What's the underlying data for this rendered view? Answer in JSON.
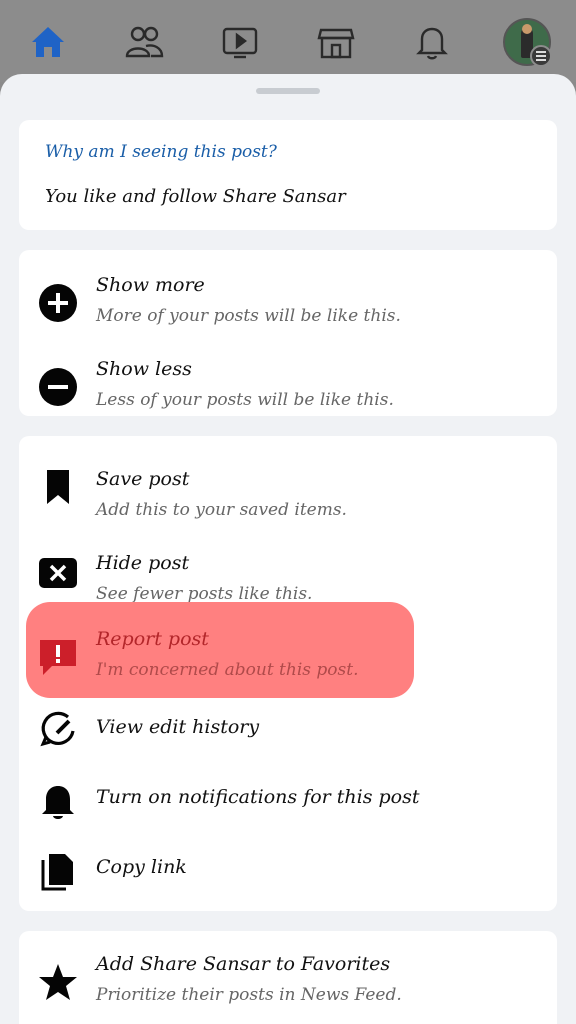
{
  "nav": {
    "icons": [
      "home-icon",
      "friends-icon",
      "watch-icon",
      "marketplace-icon",
      "bell-icon",
      "avatar"
    ]
  },
  "why": {
    "title": "Why am I seeing this post?",
    "reason": "You like and follow Share Sansar"
  },
  "feed_controls": [
    {
      "label": "Show more",
      "sub": "More of your posts will be like this.",
      "icon": "plus-circle-icon"
    },
    {
      "label": "Show less",
      "sub": "Less of your posts will be like this.",
      "icon": "minus-circle-icon"
    }
  ],
  "actions": [
    {
      "label": "Save post",
      "sub": "Add this to your saved items.",
      "icon": "bookmark-icon"
    },
    {
      "label": "Hide post",
      "sub": "See fewer posts like this.",
      "icon": "close-box-icon"
    },
    {
      "label": "Report post",
      "sub": "I'm concerned about this post.",
      "icon": "report-icon"
    },
    {
      "label": "View edit history",
      "icon": "edit-history-icon"
    },
    {
      "label": "Turn on notifications for this post",
      "icon": "bell-icon"
    },
    {
      "label": "Copy link",
      "icon": "copy-icon"
    }
  ],
  "favorites": {
    "label": "Add Share Sansar to Favorites",
    "sub": "Prioritize their posts in News Feed.",
    "icon": "star-icon"
  },
  "colors": {
    "highlight": "#ff8080",
    "link_blue": "#1a5ea8",
    "home_active": "#1f63c6"
  }
}
